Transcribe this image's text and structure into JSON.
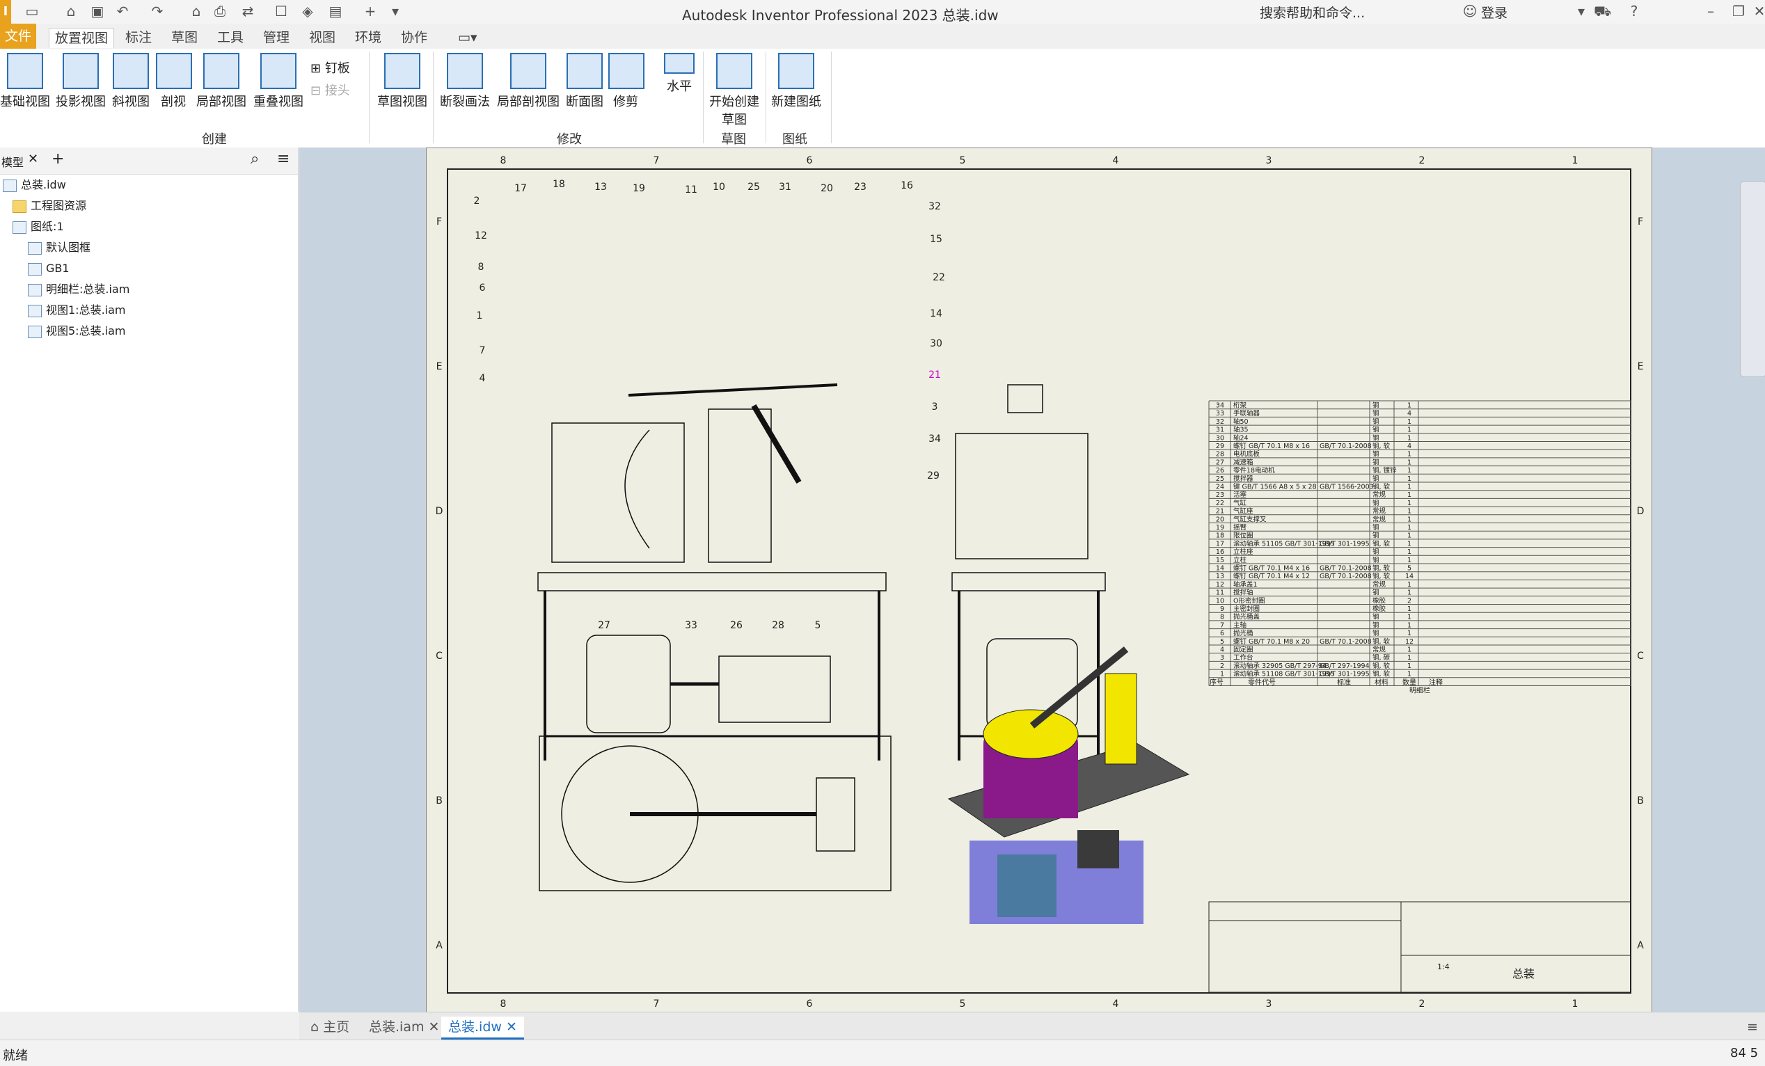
{
  "titlebar": {
    "title": "Autodesk Inventor Professional 2023    总装.idw",
    "help_search": "搜索帮助和命令...",
    "login": "登录",
    "logo": "I"
  },
  "menu": [
    "文件",
    "放置视图",
    "标注",
    "草图",
    "工具",
    "管理",
    "视图",
    "环境",
    "协作"
  ],
  "ribbon": {
    "create": {
      "label": "创建",
      "buttons": [
        "基础视图",
        "投影视图",
        "斜视图",
        "剖视",
        "局部视图",
        "重叠视图"
      ],
      "small": [
        "钉板",
        "接头"
      ]
    },
    "sketch_view": "草图视图",
    "modify": {
      "label": "修改",
      "buttons": [
        "断裂画法",
        "局部剖视图",
        "断面图",
        "修剪"
      ],
      "align": "水平"
    },
    "sketch": {
      "label": "草图",
      "button": "开始创建草图"
    },
    "sheet": {
      "label": "图纸",
      "button": "新建图纸"
    }
  },
  "browser": {
    "tab": "模型",
    "items": [
      "总装.idw",
      "工程图资源",
      "图纸:1",
      "默认图框",
      "GB1",
      "明细栏:总装.iam",
      "视图1:总装.iam",
      "视图5:总装.iam"
    ]
  },
  "sheet": {
    "zone_cols": [
      "8",
      "7",
      "6",
      "5",
      "4",
      "3",
      "2",
      "1"
    ],
    "zone_rows": [
      "F",
      "E",
      "D",
      "C",
      "B",
      "A"
    ],
    "balloons_front": [
      "17",
      "18",
      "13",
      "19",
      "11",
      "10",
      "25",
      "31",
      "20",
      "23",
      "16",
      "2",
      "12",
      "8",
      "6",
      "1",
      "7",
      "4",
      "32",
      "15",
      "22",
      "14",
      "30",
      "21",
      "3",
      "34",
      "29",
      "27",
      "33",
      "26",
      "28",
      "5"
    ]
  },
  "bom": {
    "rows": [
      [
        "34",
        "桁架",
        "",
        "钢",
        "1"
      ],
      [
        "33",
        "手联轴器",
        "",
        "钢",
        "4"
      ],
      [
        "32",
        "轴50",
        "",
        "钢",
        "1"
      ],
      [
        "31",
        "轴35",
        "",
        "钢",
        "1"
      ],
      [
        "30",
        "轴24",
        "",
        "钢",
        "1"
      ],
      [
        "29",
        "螺钉 GB/T 70.1 M8 x 16",
        "GB/T 70.1-2008",
        "钢, 软",
        "4"
      ],
      [
        "28",
        "电机底板",
        "",
        "钢",
        "1"
      ],
      [
        "27",
        "减速箱",
        "",
        "钢",
        "1"
      ],
      [
        "26",
        "零件18电动机",
        "",
        "钢, 镀锌",
        "1"
      ],
      [
        "25",
        "搅拌器",
        "",
        "钢",
        "1"
      ],
      [
        "24",
        "键 GB/T 1566 A8 x 5 x 28",
        "GB/T 1566-2003",
        "钢, 软",
        "1"
      ],
      [
        "23",
        "活塞",
        "",
        "常规",
        "1"
      ],
      [
        "22",
        "气缸",
        "",
        "钢",
        "1"
      ],
      [
        "21",
        "气缸座",
        "",
        "常规",
        "1"
      ],
      [
        "20",
        "气缸支撑叉",
        "",
        "常规",
        "1"
      ],
      [
        "19",
        "摇臂",
        "",
        "钢",
        "1"
      ],
      [
        "18",
        "限位圈",
        "",
        "钢",
        "1"
      ],
      [
        "17",
        "滚动轴承 51105 GB/T 301-1995",
        "GB/T 301-1995",
        "钢, 软",
        "1"
      ],
      [
        "16",
        "立柱座",
        "",
        "钢",
        "1"
      ],
      [
        "15",
        "立柱",
        "",
        "钢",
        "1"
      ],
      [
        "14",
        "螺钉 GB/T 70.1 M4 x 16",
        "GB/T 70.1-2008",
        "钢, 软",
        "5"
      ],
      [
        "13",
        "螺钉 GB/T 70.1 M4 x 12",
        "GB/T 70.1-2008",
        "钢, 软",
        "14"
      ],
      [
        "12",
        "轴承盖1",
        "",
        "常规",
        "1"
      ],
      [
        "11",
        "搅拌轴",
        "",
        "钢",
        "1"
      ],
      [
        "10",
        "O形密封圈",
        "",
        "橡胶",
        "2"
      ],
      [
        "9",
        "主密封圈",
        "",
        "橡胶",
        "1"
      ],
      [
        "8",
        "抛光桶盖",
        "",
        "钢",
        "1"
      ],
      [
        "7",
        "主轴",
        "",
        "钢",
        "1"
      ],
      [
        "6",
        "抛光桶",
        "",
        "钢",
        "1"
      ],
      [
        "5",
        "螺钉 GB/T 70.1 M8 x 20",
        "GB/T 70.1-2008",
        "钢, 软",
        "12"
      ],
      [
        "4",
        "固定圈",
        "",
        "常规",
        "1"
      ],
      [
        "3",
        "工作台",
        "",
        "钢, 碳",
        "1"
      ],
      [
        "2",
        "滚动轴承 32905 GB/T 297-94",
        "GB/T 297-1994",
        "钢, 软",
        "1"
      ],
      [
        "1",
        "滚动轴承 51108 GB/T 301-1995",
        "GB/T 301-1995",
        "钢, 软",
        "1"
      ]
    ],
    "header": [
      "序号",
      "零件代号",
      "标准",
      "材料",
      "数量",
      "注释"
    ],
    "caption": "明细栏"
  },
  "titleblock": {
    "name": "总装",
    "scale": "1:4"
  },
  "doc_tabs": [
    "主页",
    "总装.iam",
    "总装.idw"
  ],
  "status": {
    "left": "就绪",
    "right": "84  5"
  },
  "colors": {
    "accent": "#e8a21d",
    "sheet": "#eeeee2",
    "canvas": "#c8d3e0",
    "bowl": "#8a1a8a",
    "lid": "#f2e600",
    "frame": "#6b6bd8",
    "motor": "#4a7aa0"
  }
}
